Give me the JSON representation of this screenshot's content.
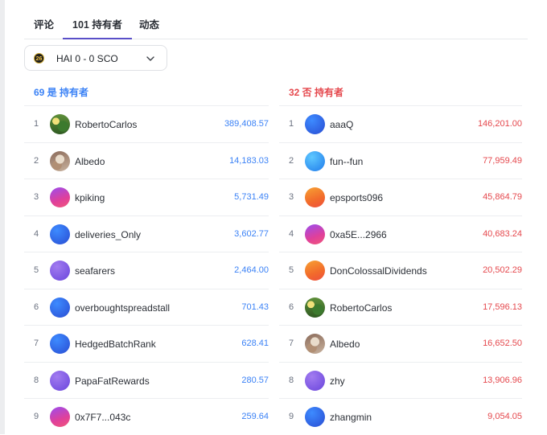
{
  "tabs": [
    {
      "label": "评论"
    },
    {
      "label": "101 持有者"
    },
    {
      "label": "动态"
    }
  ],
  "market_select": {
    "icon_text": "26",
    "label": "HAI 0 - 0 SCO"
  },
  "colors": {
    "yes": "#3b82f6",
    "no": "#e5484d",
    "tab_active": "#5a4fc8"
  },
  "yes_column": {
    "header": "69 是 持有者",
    "rows": [
      {
        "rank": "1",
        "name": "RobertoCarlos",
        "amount": "389,408.57",
        "avatar": "photo-field"
      },
      {
        "rank": "2",
        "name": "Albedo",
        "amount": "14,183.03",
        "avatar": "photo-dog"
      },
      {
        "rank": "3",
        "name": "kpiking",
        "amount": "5,731.49",
        "avatar": "gradient-pink-purple"
      },
      {
        "rank": "4",
        "name": "deliveries_Only",
        "amount": "3,602.77",
        "avatar": "gradient-blue"
      },
      {
        "rank": "5",
        "name": "seafarers",
        "amount": "2,464.00",
        "avatar": "gradient-violet"
      },
      {
        "rank": "6",
        "name": "overboughtspreadstall",
        "amount": "701.43",
        "avatar": "gradient-blue"
      },
      {
        "rank": "7",
        "name": "HedgedBatchRank",
        "amount": "628.41",
        "avatar": "gradient-blue"
      },
      {
        "rank": "8",
        "name": "PapaFatRewards",
        "amount": "280.57",
        "avatar": "gradient-violet"
      },
      {
        "rank": "9",
        "name": "0x7F7...043c",
        "amount": "259.64",
        "avatar": "gradient-pink-purple"
      }
    ]
  },
  "no_column": {
    "header": "32 否 持有者",
    "rows": [
      {
        "rank": "1",
        "name": "aaaQ",
        "amount": "146,201.00",
        "avatar": "gradient-blue"
      },
      {
        "rank": "2",
        "name": "fun--fun",
        "amount": "77,959.49",
        "avatar": "gradient-sky"
      },
      {
        "rank": "3",
        "name": "epsports096",
        "amount": "45,864.79",
        "avatar": "gradient-orange"
      },
      {
        "rank": "4",
        "name": "0xa5E...2966",
        "amount": "40,683.24",
        "avatar": "gradient-pink-purple"
      },
      {
        "rank": "5",
        "name": "DonColossalDividends",
        "amount": "20,502.29",
        "avatar": "gradient-orange"
      },
      {
        "rank": "6",
        "name": "RobertoCarlos",
        "amount": "17,596.13",
        "avatar": "photo-field"
      },
      {
        "rank": "7",
        "name": "Albedo",
        "amount": "16,652.50",
        "avatar": "photo-dog"
      },
      {
        "rank": "8",
        "name": "zhy",
        "amount": "13,906.96",
        "avatar": "gradient-violet"
      },
      {
        "rank": "9",
        "name": "zhangmin",
        "amount": "9,054.05",
        "avatar": "gradient-blue"
      }
    ]
  }
}
